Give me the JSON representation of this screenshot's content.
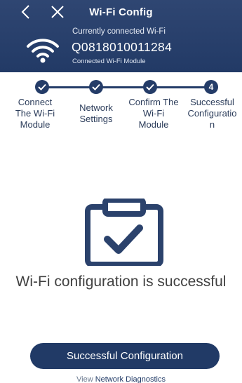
{
  "header": {
    "title": "Wi-Fi Config",
    "connected_label": "Currently connected Wi-Fi",
    "ssid": "Q0818010011284",
    "module_label": "Connected Wi-Fi Module",
    "background_color": "#223a66"
  },
  "stepper": {
    "steps": [
      {
        "label_lines": [
          "Connect",
          "The Wi-Fi",
          "Module"
        ],
        "state": "done"
      },
      {
        "label_lines": [
          "Network",
          "Settings"
        ],
        "state": "done"
      },
      {
        "label_lines": [
          "Confirm The",
          "Wi-Fi",
          "Module"
        ],
        "state": "done"
      },
      {
        "number": "4",
        "label_lines": [
          "Successful",
          "Configuratio",
          "n"
        ],
        "state": "current"
      }
    ]
  },
  "main": {
    "icon": "clipboard-check-icon",
    "success_message": "Wi-Fi configuration is successful"
  },
  "footer": {
    "button_label": "Successful Configuration",
    "link_prefix": "View",
    "link_text": "Network Diagnostics",
    "accent_color": "#213a66"
  }
}
